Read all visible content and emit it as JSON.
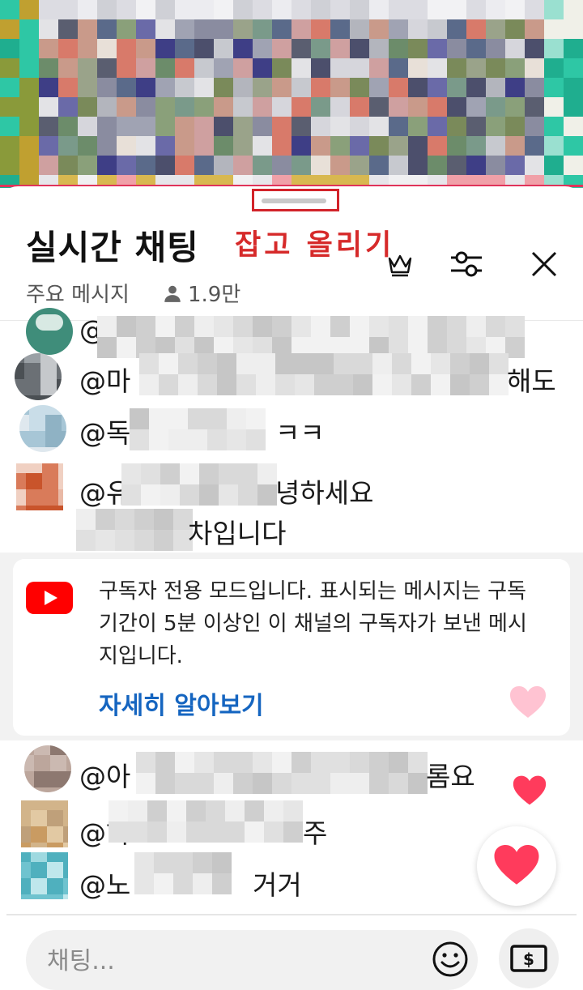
{
  "chat_panel": {
    "title": "실시간 채팅",
    "annotation": "잡고 올리기",
    "filter_label": "주요 메시지",
    "viewer_count": "1.9만"
  },
  "messages": [
    {
      "prefix": "@",
      "suffix": ""
    },
    {
      "prefix": "@마",
      "suffix": "해도"
    },
    {
      "prefix": "@독",
      "suffix": "ㅋㅋ"
    },
    {
      "prefix": "@유",
      "suffix": "녕하세요",
      "line2": "차입니다"
    },
    {
      "prefix": "@아",
      "suffix": "롬요"
    },
    {
      "prefix": "@하",
      "suffix": "주"
    },
    {
      "prefix": "@노",
      "suffix": "거거"
    }
  ],
  "notice": {
    "text": "구독자 전용 모드입니다. 표시되는 메시지는 구독 기간이 5분 이상인 이 채널의 구독자가 보낸 메시지입니다.",
    "link": "자세히 알아보기"
  },
  "input": {
    "placeholder": "채팅..."
  },
  "icons": {
    "crown": "crown-icon",
    "settings": "sliders-icon",
    "close": "close-icon",
    "youtube": "youtube-logo-icon",
    "emoji": "emoji-icon",
    "super_chat": "super-chat-dollar-icon",
    "heart": "heart-icon"
  },
  "colors": {
    "annotation_red": "#d62a2a",
    "link_blue": "#1565c0",
    "youtube_red": "#ff0000",
    "heart": "#ff3b5c"
  }
}
